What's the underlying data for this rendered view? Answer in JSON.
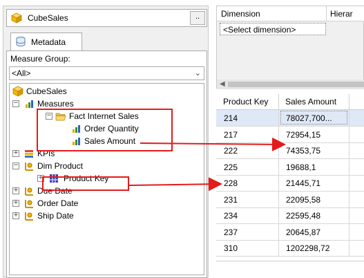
{
  "cube_selector": {
    "name": "CubeSales",
    "browse_label": ".."
  },
  "tab": {
    "label": "Metadata"
  },
  "measure_group": {
    "label": "Measure Group:",
    "value": "<All>"
  },
  "tree": {
    "root": "CubeSales",
    "measures": "Measures",
    "fact_folder": "Fact Internet Sales",
    "order_quantity": "Order Quantity",
    "sales_amount": "Sales Amount",
    "kpis": "KPIs",
    "dim_product": "Dim Product",
    "product_key": "Product Key",
    "due_date": "Due Date",
    "order_date": "Order Date",
    "ship_date": "Ship Date"
  },
  "dimension_grid": {
    "col_dimension": "Dimension",
    "col_hierarchy": "Hierar",
    "placeholder": "<Select dimension>"
  },
  "results": {
    "headers": [
      "Product Key",
      "Sales Amount"
    ],
    "rows": [
      {
        "key": "214",
        "amount": "78027,700..."
      },
      {
        "key": "217",
        "amount": "72954,15"
      },
      {
        "key": "222",
        "amount": "74353,75"
      },
      {
        "key": "225",
        "amount": "19688,1"
      },
      {
        "key": "228",
        "amount": "21445,71"
      },
      {
        "key": "231",
        "amount": "22095,58"
      },
      {
        "key": "234",
        "amount": "22595,48"
      },
      {
        "key": "237",
        "amount": "20645,87"
      },
      {
        "key": "310",
        "amount": "1202298,72"
      }
    ]
  },
  "colors": {
    "highlight": "#e51a1a",
    "selected_row": "#dfe8f6"
  }
}
